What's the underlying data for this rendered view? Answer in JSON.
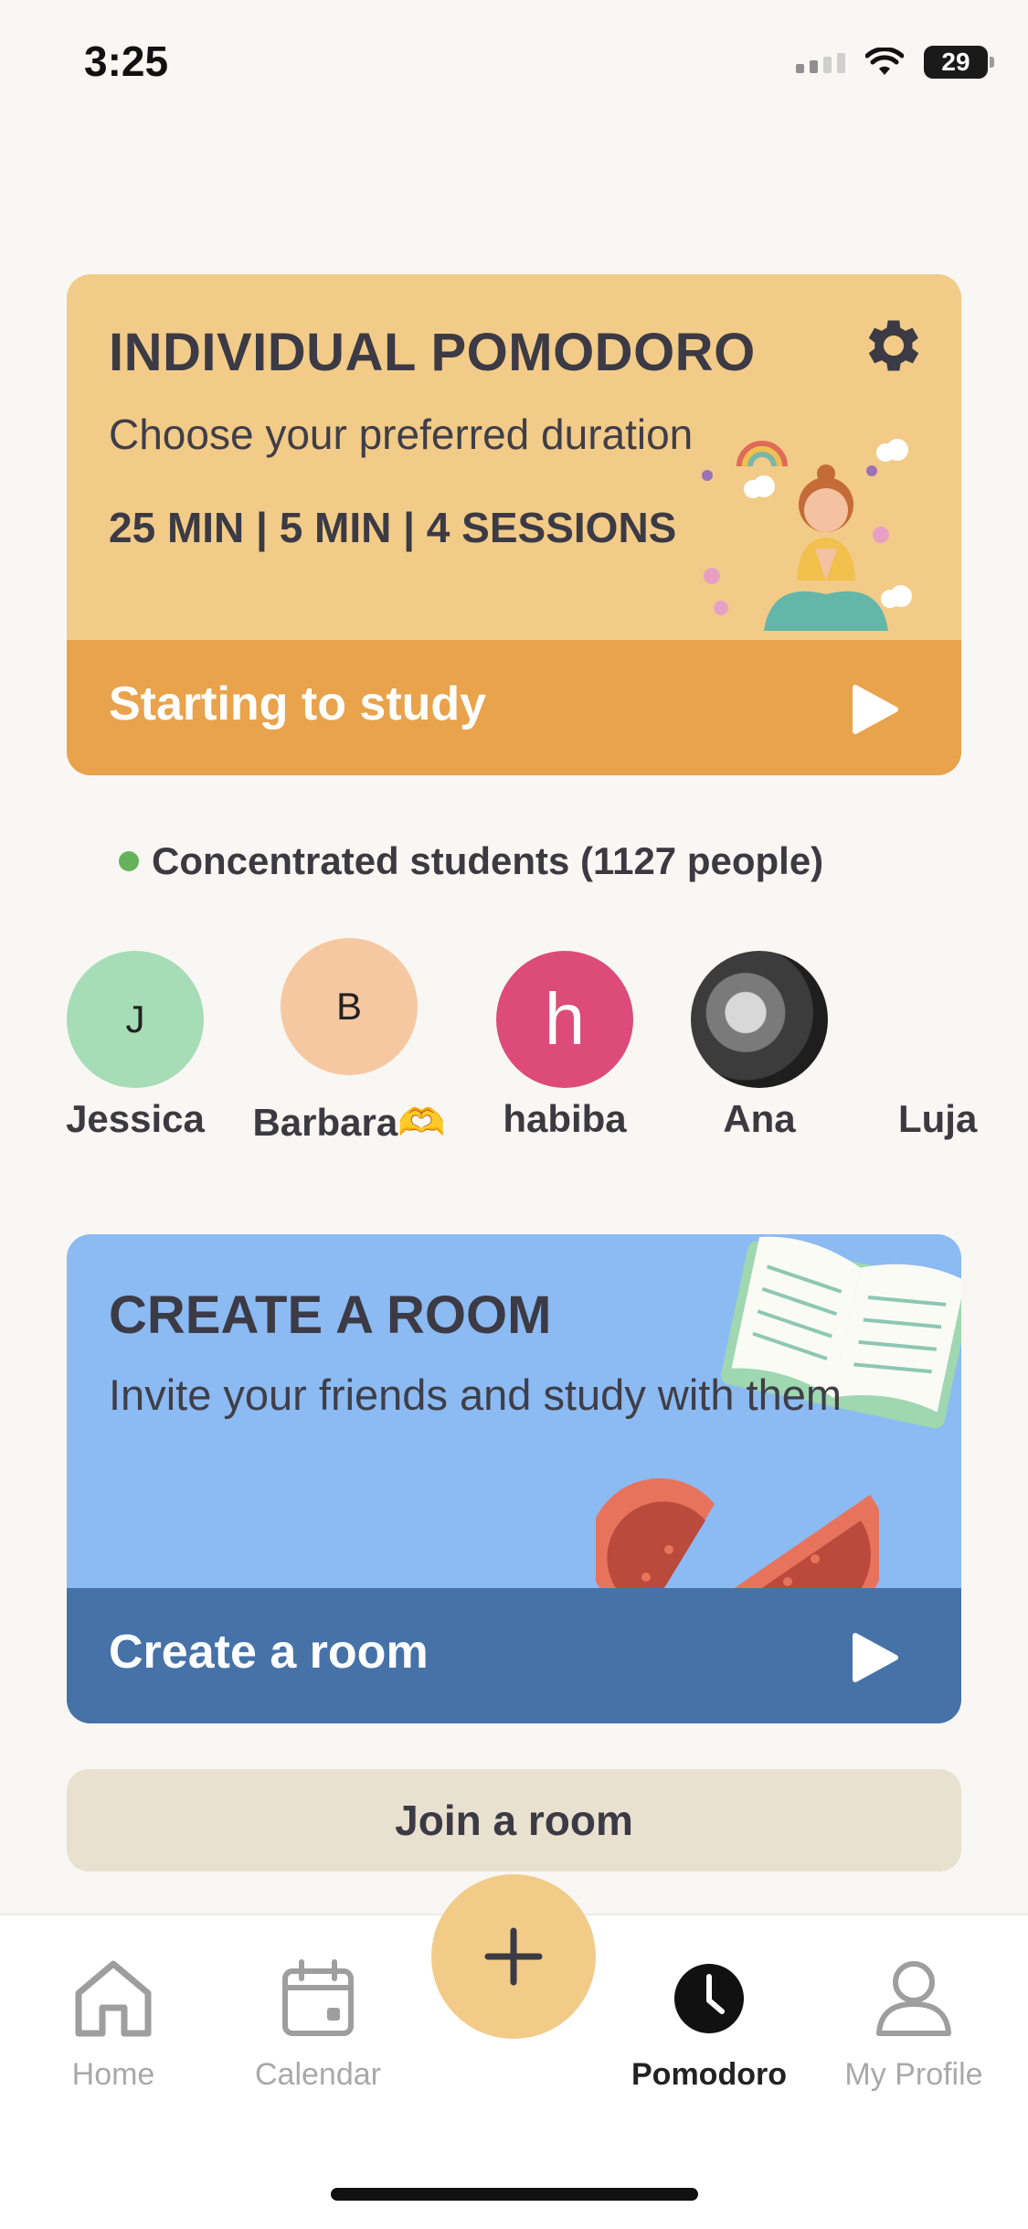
{
  "status_bar": {
    "time": "3:25",
    "battery": "29"
  },
  "pomodoro_card": {
    "title": "INDIVIDUAL POMODORO",
    "subtitle": "Choose your preferred duration",
    "stats": "25 MIN | 5 MIN | 4 SESSIONS",
    "action_label": "Starting to study",
    "bg_color": "#f2cb88",
    "bar_color": "#e8a34c"
  },
  "concentrated": {
    "label": "Concentrated students (1127 people)"
  },
  "students": [
    {
      "initial": "J",
      "name": "Jessica",
      "color": "#a6dcb6"
    },
    {
      "initial": "B",
      "name": "Barbara🫶",
      "color": "#f6c8a2"
    },
    {
      "initial": "h",
      "name": "habiba",
      "color": "#dc4b79"
    },
    {
      "initial": "",
      "name": "Ana",
      "color": "#6b6b6b"
    },
    {
      "initial": "",
      "name": "Luja",
      "color": "#f8f7f3"
    }
  ],
  "room_card": {
    "title": "CREATE A ROOM",
    "subtitle": "Invite your friends and study with them",
    "action_label": "Create a room",
    "bg_color": "#8cbaf2",
    "bar_color": "#4672a8"
  },
  "join_room": {
    "label": "Join a room"
  },
  "tabbar": {
    "home": "Home",
    "calendar": "Calendar",
    "pomodoro": "Pomodoro",
    "profile": "My Profile",
    "active": "Pomodoro"
  }
}
